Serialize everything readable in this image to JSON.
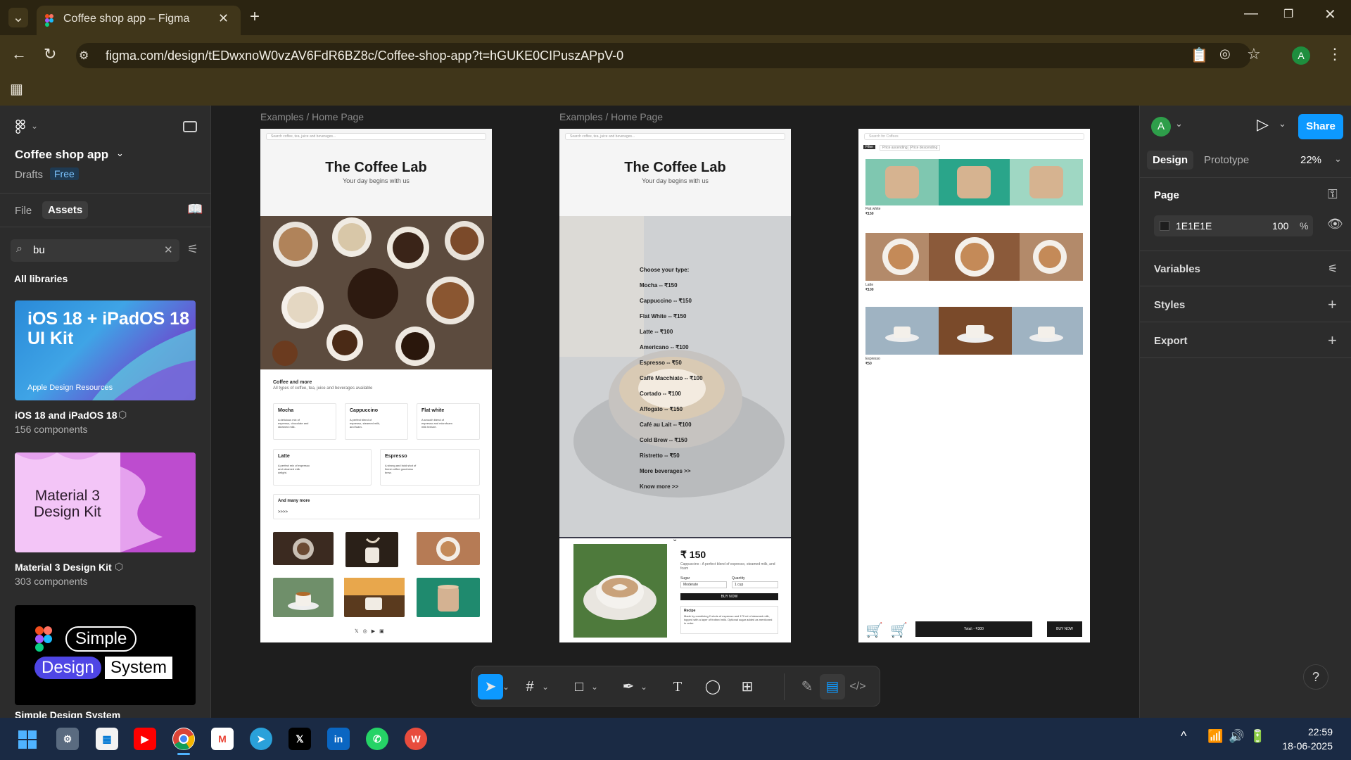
{
  "browser": {
    "tab_title": "Coffee shop app – Figma",
    "url": "figma.com/design/tEDwxnoW0vzAV6FdR6BZ8c/Coffee-shop-app?t=hGUKE0CIPuszAPpV-0",
    "profile_initial": "A"
  },
  "left_panel": {
    "file_name": "Coffee shop app",
    "location": "Drafts",
    "plan_badge": "Free",
    "tabs": [
      "File",
      "Assets"
    ],
    "search_value": "bu",
    "section_title": "All libraries",
    "libraries": [
      {
        "thumb_title": "iOS 18 + iPadOS 18\nUI Kit",
        "thumb_sub": "Apple Design Resources",
        "name": "iOS 18 and iPadOS 18",
        "count": "156 components"
      },
      {
        "thumb_title": "Material 3\nDesign Kit",
        "name": "Material 3 Design Kit",
        "count": "303 components"
      },
      {
        "thumb_words": [
          "Simple",
          "Design",
          "System"
        ],
        "name": "Simple Design System"
      }
    ]
  },
  "canvas": {
    "frame1_label": "Examples / Home Page",
    "frame2_label": "Examples / Home Page",
    "search_placeholder": "Search coffee, tea, juice and beverages...",
    "brand_title": "The Coffee Lab",
    "brand_tagline": "Your day begins with us",
    "section_title": "Coffee and more",
    "section_sub": "All types of coffee, tea, juice and beverages available",
    "cards": [
      {
        "name": "Mocha",
        "desc": "A delicious mix of espresso, chocolate and steamed milk."
      },
      {
        "name": "Cappuccino",
        "desc": "A perfect blend of espresso, steamed milk, and foam."
      },
      {
        "name": "Flat white",
        "desc": "A smooth blend of espresso and microfoam milk texture."
      },
      {
        "name": "Latte",
        "desc": "A perfect mix of espresso and steamed milk delight."
      },
      {
        "name": "Espresso",
        "desc": "A strong and bold shot of finest coffee goodness brew."
      }
    ],
    "more_title": "And many more",
    "more_arrows": ">>>>",
    "menu_heading": "Choose your type:",
    "menu_items": [
      "Mocha -- ₹150",
      "Cappuccino -- ₹150",
      "Flat White -- ₹150",
      "Latte -- ₹100",
      "Americano -- ₹100",
      "Espresso -- ₹50",
      "Caffè Macchiato -- ₹100",
      "Cortado -- ₹100",
      "Affogato -- ₹150",
      "Café au Lait -- ₹100",
      "Cold Brew -- ₹150",
      "Ristretto -- ₹50",
      "More beverages >>",
      "Know more >>"
    ],
    "product_price": "₹ 150",
    "product_desc": "Cappuccino - A perfect blend of espresso, steamed milk, and foam",
    "sugar_label": "Sugar",
    "sugar_value": "Moderate",
    "qty_label": "Quantity",
    "qty_value": "1 cup",
    "buy_now": "BUY NOW",
    "recipe_title": "Recipe",
    "recipe_text": "Made by combining 2 shots of espresso and 170 ml of steamed milk, topped with a layer of frothed milk. Optional sugar added as mentioned in order.",
    "frame3_search": "Search for Coffees",
    "filters": [
      "Filter",
      "Price ascending",
      "Price descending"
    ],
    "products": [
      {
        "name": "Flat white",
        "price": "₹150"
      },
      {
        "name": "Latte",
        "price": "₹100"
      },
      {
        "name": "Espresso",
        "price": "₹50"
      }
    ],
    "total": "Total :- ₹300",
    "buy_now_small": "BUY NOW"
  },
  "right_panel": {
    "avatar_initial": "A",
    "share_label": "Share",
    "tabs": [
      "Design",
      "Prototype"
    ],
    "zoom": "22%",
    "page_title": "Page",
    "bg_color_hex": "1E1E1E",
    "bg_opacity": "100",
    "percent_sign": "%",
    "sections": [
      "Variables",
      "Styles",
      "Export"
    ]
  },
  "taskbar": {
    "time": "22:59",
    "date": "18-06-2025"
  },
  "colors": {
    "figma_blue": "#0d99ff",
    "chrome_dark": "#2b2411",
    "chrome_mid": "#40361a"
  }
}
